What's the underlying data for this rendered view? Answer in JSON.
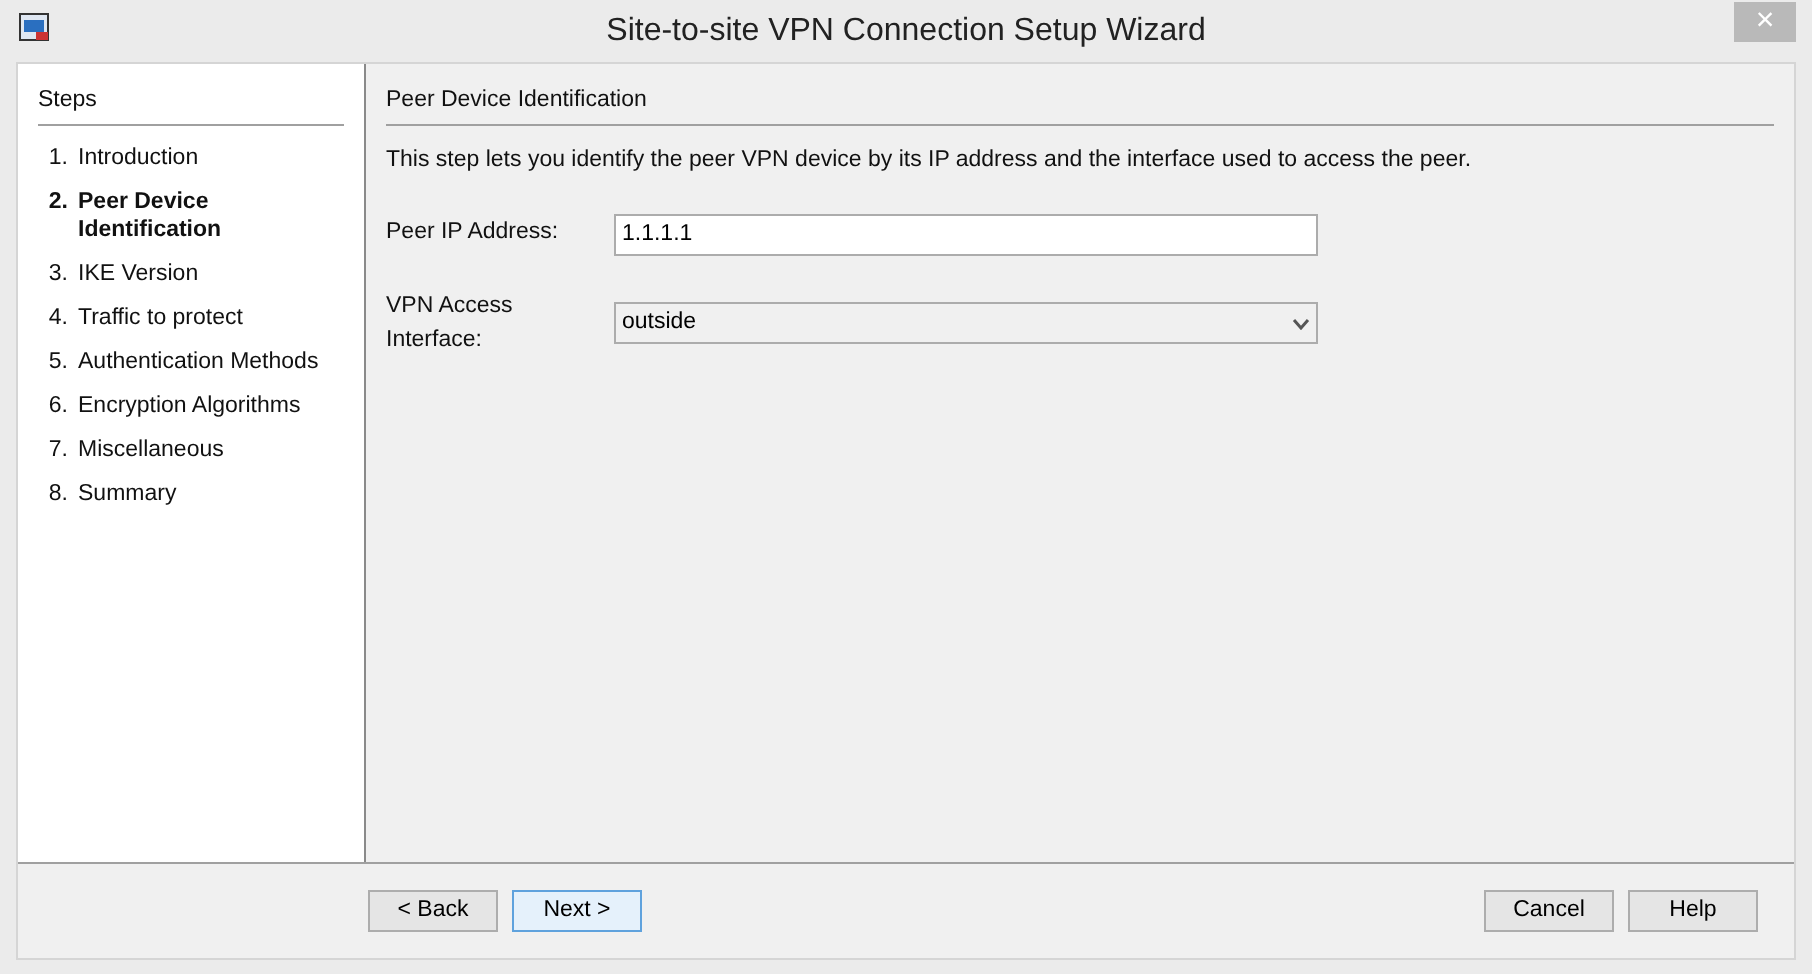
{
  "window": {
    "title": "Site-to-site VPN Connection Setup Wizard",
    "close": "×"
  },
  "steps": {
    "title": "Steps",
    "items": [
      {
        "number": "1.",
        "label": "Introduction",
        "selected": false
      },
      {
        "number": "2.",
        "label": "Peer Device Identification",
        "selected": true
      },
      {
        "number": "3.",
        "label": "IKE Version",
        "selected": false
      },
      {
        "number": "4.",
        "label": "Traffic to protect",
        "selected": false
      },
      {
        "number": "5.",
        "label": "Authentication Methods",
        "selected": false
      },
      {
        "number": "6.",
        "label": "Encryption Algorithms",
        "selected": false
      },
      {
        "number": "7.",
        "label": "Miscellaneous",
        "selected": false
      },
      {
        "number": "8.",
        "label": "Summary",
        "selected": false
      }
    ]
  },
  "content": {
    "title": "Peer Device Identification",
    "description": "This step lets you identify the peer VPN device by its IP address and the interface used to access the peer.",
    "fields": [
      {
        "kind": "text",
        "label": "Peer IP Address:",
        "value": "1.1.1.1"
      },
      {
        "kind": "dropdown",
        "label": "VPN Access Interface:",
        "value": "outside"
      }
    ]
  },
  "buttons_left": [
    {
      "label": "< Back",
      "default": false
    },
    {
      "label": "Next >",
      "default": true
    }
  ],
  "buttons_right": [
    {
      "label": "Cancel",
      "default": false
    },
    {
      "label": "Help",
      "default": false
    }
  ]
}
